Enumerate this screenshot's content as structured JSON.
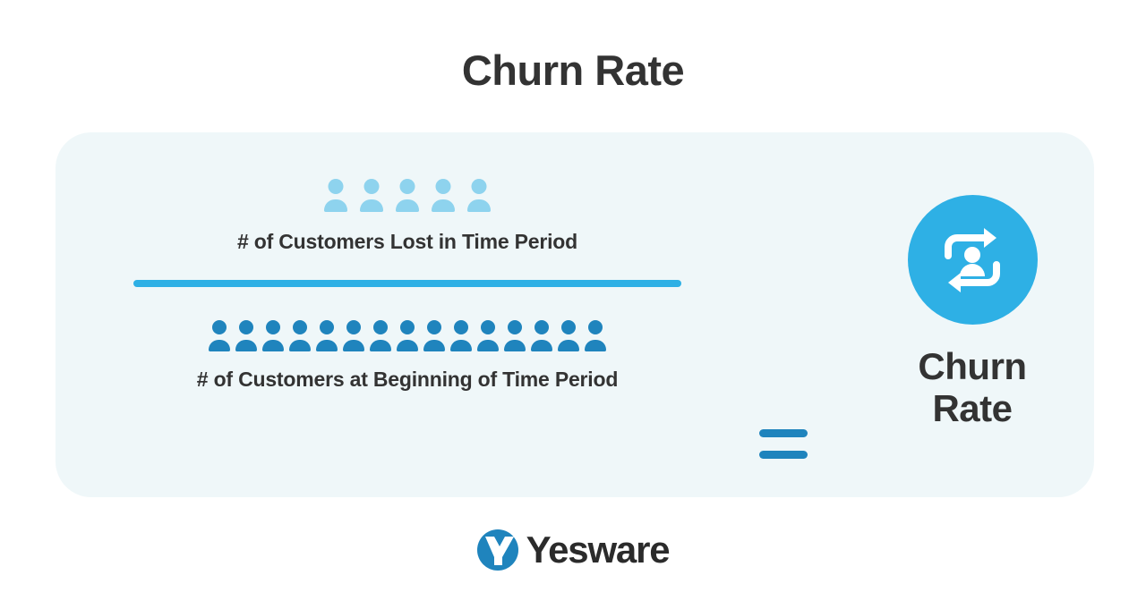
{
  "title": "Churn Rate",
  "card": {
    "background_color": "#eff7f9",
    "formula": {
      "numerator": {
        "label": "# of Customers Lost in Time Period",
        "icon_name": "person-icon",
        "icon_count": 5,
        "icon_color": "#8ed3ee"
      },
      "denominator": {
        "label": "# of Customers at Beginning of Time Period",
        "icon_name": "person-icon",
        "icon_count": 15,
        "icon_color": "#1f84bd"
      },
      "divider_color": "#2eb0e5",
      "equals_symbol": "=",
      "equals_color": "#1f84bd"
    },
    "result": {
      "badge_icon_name": "customer-turnover-icon",
      "badge_color": "#2eb0e5",
      "badge_icon_color": "#ffffff",
      "label_line_1": "Churn",
      "label_line_2": "Rate"
    }
  },
  "footer": {
    "brand_name": "Yesware",
    "logo_icon_name": "yesware-logo-icon",
    "logo_color": "#1f84bd"
  },
  "chart_data": {
    "type": "diagram",
    "title": "Churn Rate",
    "formula": "Churn Rate = (# of Customers Lost in Time Period) / (# of Customers at Beginning of Time Period)",
    "numerator_label": "# of Customers Lost in Time Period",
    "numerator_icons": 5,
    "denominator_label": "# of Customers at Beginning of Time Period",
    "denominator_icons": 15,
    "implied_ratio": 0.333,
    "brand": "Yesware"
  }
}
